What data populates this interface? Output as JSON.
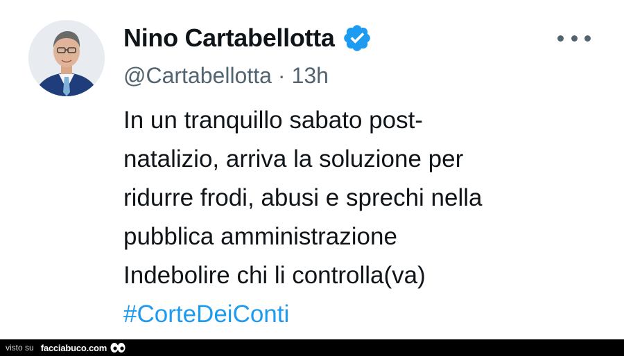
{
  "tweet": {
    "display_name": "Nino Cartabellotta",
    "verified": true,
    "handle": "@Cartabellotta",
    "separator": "·",
    "time": "13h",
    "body_lines": [
      "In un tranquillo sabato post-",
      "natalizio, arriva la soluzione per",
      "ridurre frodi, abusi e sprechi nella",
      "pubblica amministrazione",
      "Indebolire chi li controlla(va)"
    ],
    "hashtag": "#CorteDeiConti",
    "icons": {
      "avatar": "profile-photo",
      "verified": "verified-badge-icon",
      "more": "more-horizontal-icon"
    },
    "colors": {
      "text": "#0f1419",
      "secondary": "#536471",
      "link": "#1d9bf0",
      "verified": "#1d9bf0"
    }
  },
  "footer": {
    "visto_label": "visto su",
    "site_label": "facciabuco.com",
    "logo_icon": "eyes-icon",
    "background": "#000000"
  }
}
